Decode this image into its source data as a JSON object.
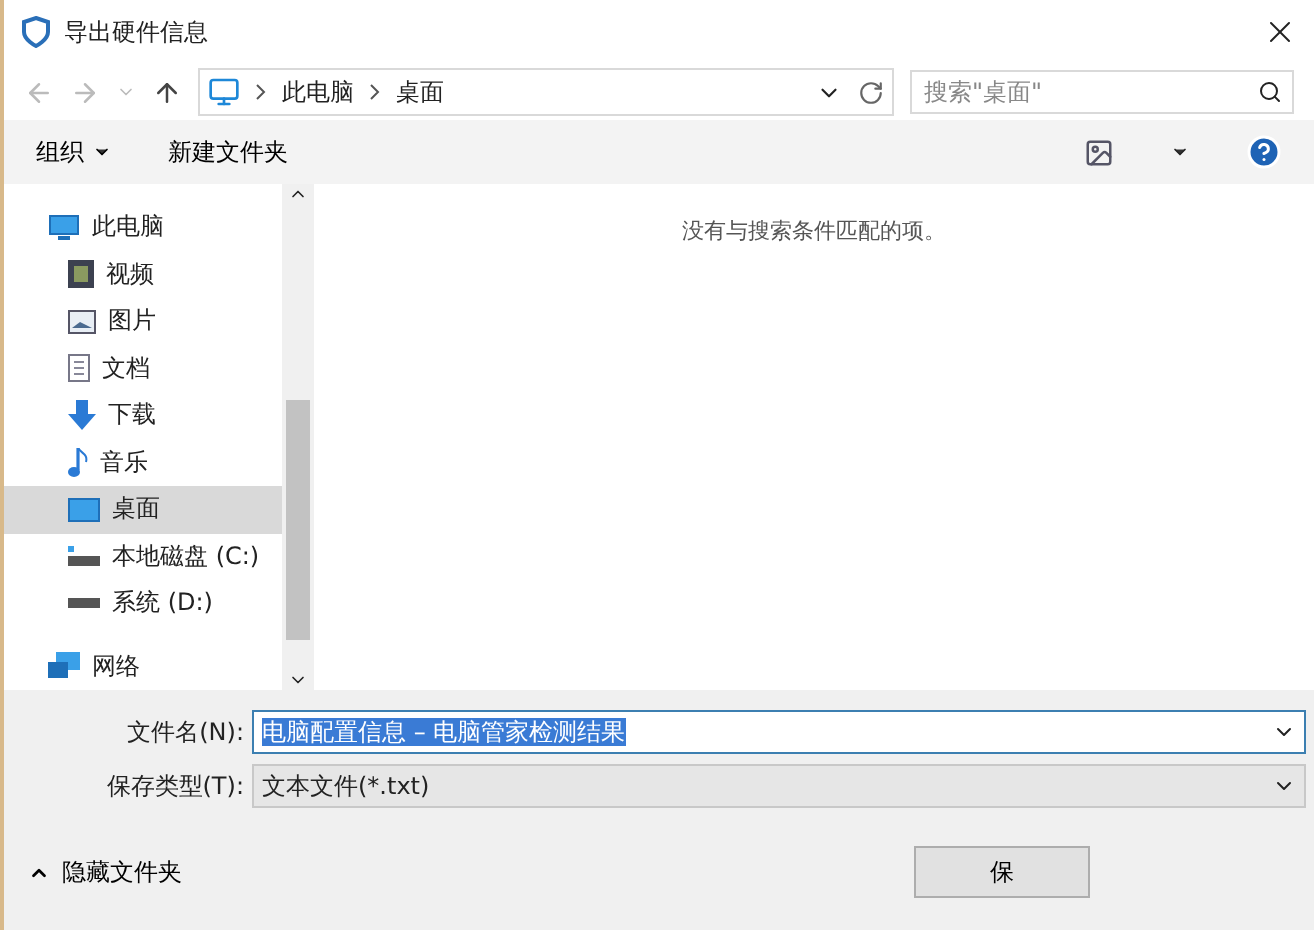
{
  "window": {
    "title": "导出硬件信息"
  },
  "address": {
    "path": [
      "此电脑",
      "桌面"
    ],
    "search_placeholder": "搜索\"桌面\""
  },
  "toolbar": {
    "organize": "组织",
    "new_folder": "新建文件夹"
  },
  "sidebar": {
    "items": [
      {
        "label": "此电脑",
        "selected": false,
        "children": [
          {
            "label": "视频",
            "selected": false
          },
          {
            "label": "图片",
            "selected": false
          },
          {
            "label": "文档",
            "selected": false
          },
          {
            "label": "下载",
            "selected": false
          },
          {
            "label": "音乐",
            "selected": false
          },
          {
            "label": "桌面",
            "selected": true
          },
          {
            "label": "本地磁盘 (C:)",
            "selected": false
          },
          {
            "label": "系统 (D:)",
            "selected": false
          }
        ]
      },
      {
        "label": "网络",
        "selected": false
      }
    ]
  },
  "content": {
    "empty_message": "没有与搜索条件匹配的项。"
  },
  "form": {
    "filename_label": "文件名(N):",
    "filename": "电脑配置信息 – 电脑管家检测结果",
    "type_label": "保存类型(T):",
    "type": "文本文件(*.txt)"
  },
  "footer": {
    "hide_folders": "隐藏文件夹",
    "buttons": [
      "保"
    ]
  }
}
